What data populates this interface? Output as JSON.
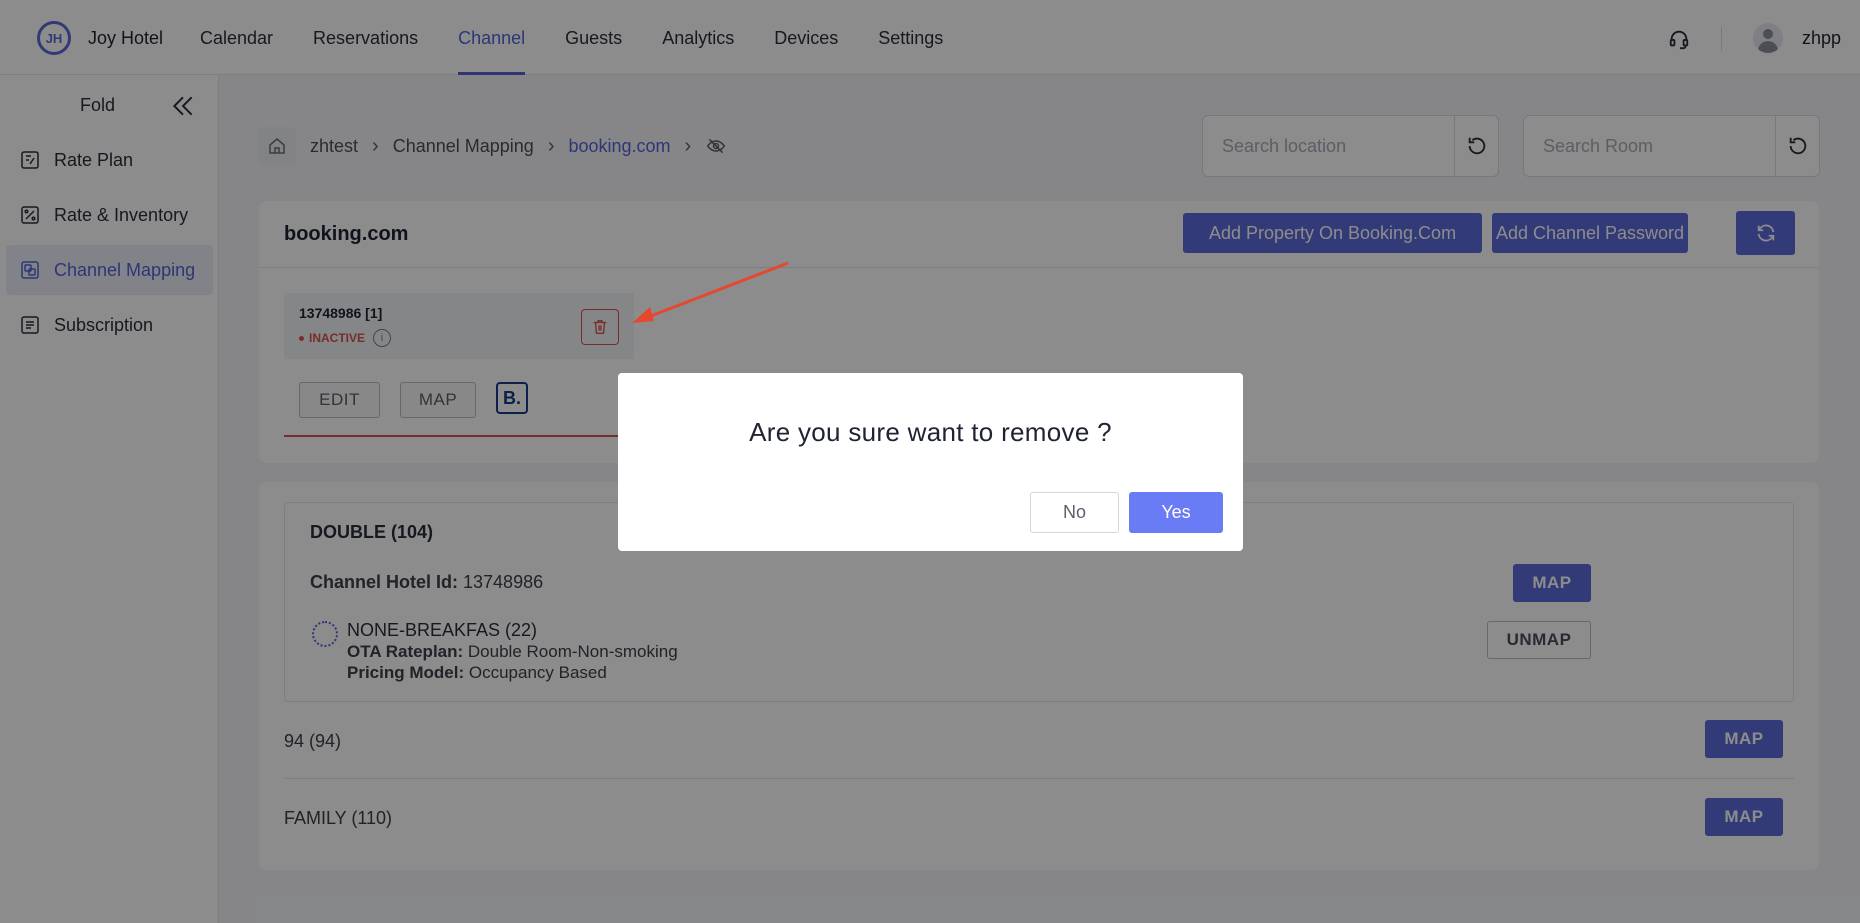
{
  "header": {
    "logo_text": "JH",
    "brand": "Joy Hotel",
    "nav": [
      {
        "label": "Calendar",
        "active": false
      },
      {
        "label": "Reservations",
        "active": false
      },
      {
        "label": "Channel",
        "active": true
      },
      {
        "label": "Guests",
        "active": false
      },
      {
        "label": "Analytics",
        "active": false
      },
      {
        "label": "Devices",
        "active": false
      },
      {
        "label": "Settings",
        "active": false
      }
    ],
    "user": "zhpp",
    "support_icon": "headset-icon"
  },
  "sidebar": {
    "fold_label": "Fold",
    "items": [
      {
        "label": "Rate Plan",
        "icon": "rate-plan-icon",
        "active": false
      },
      {
        "label": "Rate & Inventory",
        "icon": "percent-icon",
        "active": false
      },
      {
        "label": "Channel Mapping",
        "icon": "channel-icon",
        "active": true
      },
      {
        "label": "Subscription",
        "icon": "subscription-icon",
        "active": false
      }
    ]
  },
  "breadcrumb": {
    "items": [
      "zhtest",
      "Channel Mapping",
      "booking.com"
    ]
  },
  "search": {
    "location_placeholder": "Search location",
    "room_placeholder": "Search Room"
  },
  "channel_card": {
    "title": "booking.com",
    "add_property_label": "Add Property On Booking.Com",
    "add_password_label": "Add Channel Password",
    "property": {
      "id": "13748986 [1]",
      "status": "INACTIVE",
      "edit_label": "EDIT",
      "map_label": "MAP",
      "logo_text": "B."
    }
  },
  "rooms_card": {
    "rooms": [
      {
        "title": "DOUBLE (104)",
        "hotel_id_label": "Channel Hotel Id:",
        "hotel_id": "13748986",
        "map_label": "MAP",
        "rate": {
          "name": "NONE-BREAKFAS (22)",
          "ota_label": "OTA Rateplan:",
          "ota_value": "Double Room-Non-smoking",
          "pricing_label": "Pricing Model:",
          "pricing_value": "Occupancy Based",
          "unmap_label": "UNMAP"
        }
      },
      {
        "title": "94 (94)",
        "map_label": "MAP"
      },
      {
        "title": "FAMILY (110)",
        "map_label": "MAP"
      }
    ]
  },
  "dialog": {
    "message": "Are you sure want to remove ?",
    "no_label": "No",
    "yes_label": "Yes"
  },
  "colors": {
    "accent": "#5463d7",
    "danger": "#d9534f",
    "annotation_arrow": "#e8472f"
  }
}
